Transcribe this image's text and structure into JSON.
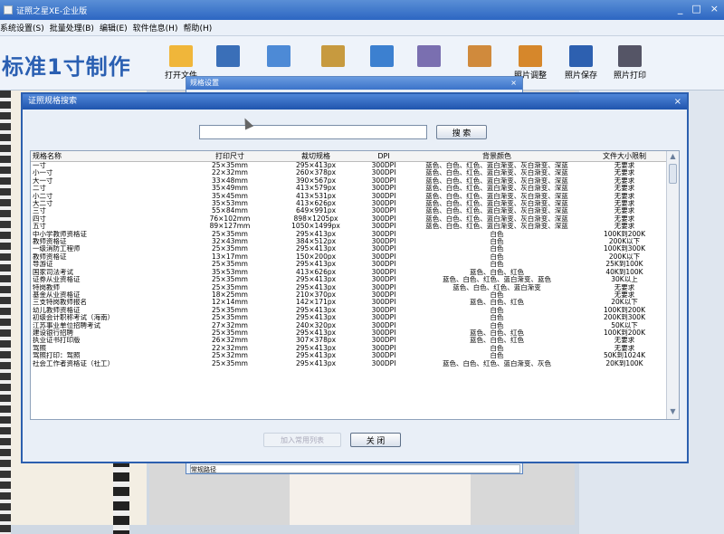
{
  "window": {
    "title": "证照之星XE-企业版",
    "controls": [
      "_",
      "□",
      "×"
    ]
  },
  "menu": [
    "系统设置(S)",
    "批量处理(B)",
    "编辑(E)",
    "软件信息(H)",
    "帮助(H)"
  ],
  "brand": "标准1寸制作",
  "toolbar": [
    {
      "label": "打开文件",
      "icon": "folder-icon",
      "color": "#f0b63a"
    },
    {
      "label": "",
      "icon": "camera-icon",
      "color": "#3a6fb8"
    },
    {
      "label": "",
      "icon": "edit-icon",
      "color": "#4d8ad6"
    },
    {
      "label": "",
      "icon": "crop-icon",
      "color": "#c79a3f"
    },
    {
      "label": "",
      "icon": "frame-icon",
      "color": "#3c80d0"
    },
    {
      "label": "",
      "icon": "layout-icon",
      "color": "#7a6fb0"
    },
    {
      "label": "",
      "icon": "settings-icon",
      "color": "#d08a3c"
    },
    {
      "label": "照片调整",
      "icon": "adjust-icon",
      "color": "#d6872b"
    },
    {
      "label": "照片保存",
      "icon": "save-icon",
      "color": "#2d60b0"
    },
    {
      "label": "照片打印",
      "icon": "print-icon",
      "color": "#556"
    }
  ],
  "behind_dialog": {
    "title": "规格设置",
    "field": "常规路径"
  },
  "dialog": {
    "title": "证照规格搜索",
    "search_value": "",
    "search_button": "搜 索",
    "add_button": "加入常用列表",
    "close_button": "关 闭",
    "columns": [
      "规格名称",
      "打印尺寸",
      "裁切规格",
      "DPI",
      "背景颜色",
      "文件大小限制"
    ],
    "rows": [
      [
        "一寸",
        "25×35mm",
        "295×413px",
        "300DPI",
        "蓝色、白色、红色、蓝白渐变、灰白渐变、深蓝",
        "无要求"
      ],
      [
        "小一寸",
        "22×32mm",
        "260×378px",
        "300DPI",
        "蓝色、白色、红色、蓝白渐变、灰白渐变、深蓝",
        "无要求"
      ],
      [
        "大一寸",
        "33×48mm",
        "390×567px",
        "300DPI",
        "蓝色、白色、红色、蓝白渐变、灰白渐变、深蓝",
        "无要求"
      ],
      [
        "二寸",
        "35×49mm",
        "413×579px",
        "300DPI",
        "蓝色、白色、红色、蓝白渐变、灰白渐变、深蓝",
        "无要求"
      ],
      [
        "小二寸",
        "35×45mm",
        "413×531px",
        "300DPI",
        "蓝色、白色、红色、蓝白渐变、灰白渐变、深蓝",
        "无要求"
      ],
      [
        "大二寸",
        "35×53mm",
        "413×626px",
        "300DPI",
        "蓝色、白色、红色、蓝白渐变、灰白渐变、深蓝",
        "无要求"
      ],
      [
        "三寸",
        "55×84mm",
        "649×991px",
        "300DPI",
        "蓝色、白色、红色、蓝白渐变、灰白渐变、深蓝",
        "无要求"
      ],
      [
        "四寸",
        "76×102mm",
        "898×1205px",
        "300DPI",
        "蓝色、白色、红色、蓝白渐变、灰白渐变、深蓝",
        "无要求"
      ],
      [
        "五寸",
        "89×127mm",
        "1050×1499px",
        "300DPI",
        "蓝色、白色、红色、蓝白渐变、灰白渐变、深蓝",
        "无要求"
      ],
      [
        "中小学教师资格证",
        "25×35mm",
        "295×413px",
        "300DPI",
        "白色",
        "100K到200K"
      ],
      [
        "教师资格证",
        "32×43mm",
        "384×512px",
        "300DPI",
        "白色",
        "200K以下"
      ],
      [
        "一级消防工程师",
        "25×35mm",
        "295×413px",
        "300DPI",
        "白色",
        "100K到300K"
      ],
      [
        "教师资格证",
        "13×17mm",
        "150×200px",
        "300DPI",
        "白色",
        "200K以下"
      ],
      [
        "导游证",
        "25×35mm",
        "295×413px",
        "300DPI",
        "白色",
        "25K到100K"
      ],
      [
        "国家司法考试",
        "35×53mm",
        "413×626px",
        "300DPI",
        "蓝色、白色、红色",
        "40K到100K"
      ],
      [
        "证券从业资格证",
        "25×35mm",
        "295×413px",
        "300DPI",
        "蓝色、白色、红色、蓝白渐变、蓝色",
        "30K以上"
      ],
      [
        "特岗教师",
        "25×35mm",
        "295×413px",
        "300DPI",
        "蓝色、白色、红色、蓝白渐变",
        "无要求"
      ],
      [
        "基金从业资格证",
        "18×25mm",
        "210×370px",
        "300DPI",
        "白色",
        "无要求"
      ],
      [
        "三支特岗教师报名",
        "12×14mm",
        "142×171px",
        "300DPI",
        "蓝色、白色、红色",
        "20K以下"
      ],
      [
        "幼儿教师资格证",
        "25×35mm",
        "295×413px",
        "300DPI",
        "白色",
        "100K到200K"
      ],
      [
        "初级会计职称考试（海南）",
        "25×35mm",
        "295×413px",
        "300DPI",
        "白色",
        "200K到300K"
      ],
      [
        "江苏事业单位招聘考试",
        "27×32mm",
        "240×320px",
        "300DPI",
        "白色",
        "50K以下"
      ],
      [
        "建设银行招聘",
        "25×35mm",
        "295×413px",
        "300DPI",
        "蓝色、白色、红色",
        "100K到200K"
      ],
      [
        "执业证书打印版",
        "26×32mm",
        "307×378px",
        "300DPI",
        "蓝色、白色、红色",
        "无要求"
      ],
      [
        "驾照",
        "22×32mm",
        "295×413px",
        "300DPI",
        "白色",
        "无要求"
      ],
      [
        "驾照打印：驾照",
        "25×32mm",
        "295×413px",
        "300DPI",
        "白色",
        "50K到1024K"
      ],
      [
        "社会工作者资格证（社工）",
        "25×35mm",
        "295×413px",
        "300DPI",
        "蓝色、白色、红色、蓝白渐变、灰色",
        "20K到100K"
      ]
    ]
  }
}
